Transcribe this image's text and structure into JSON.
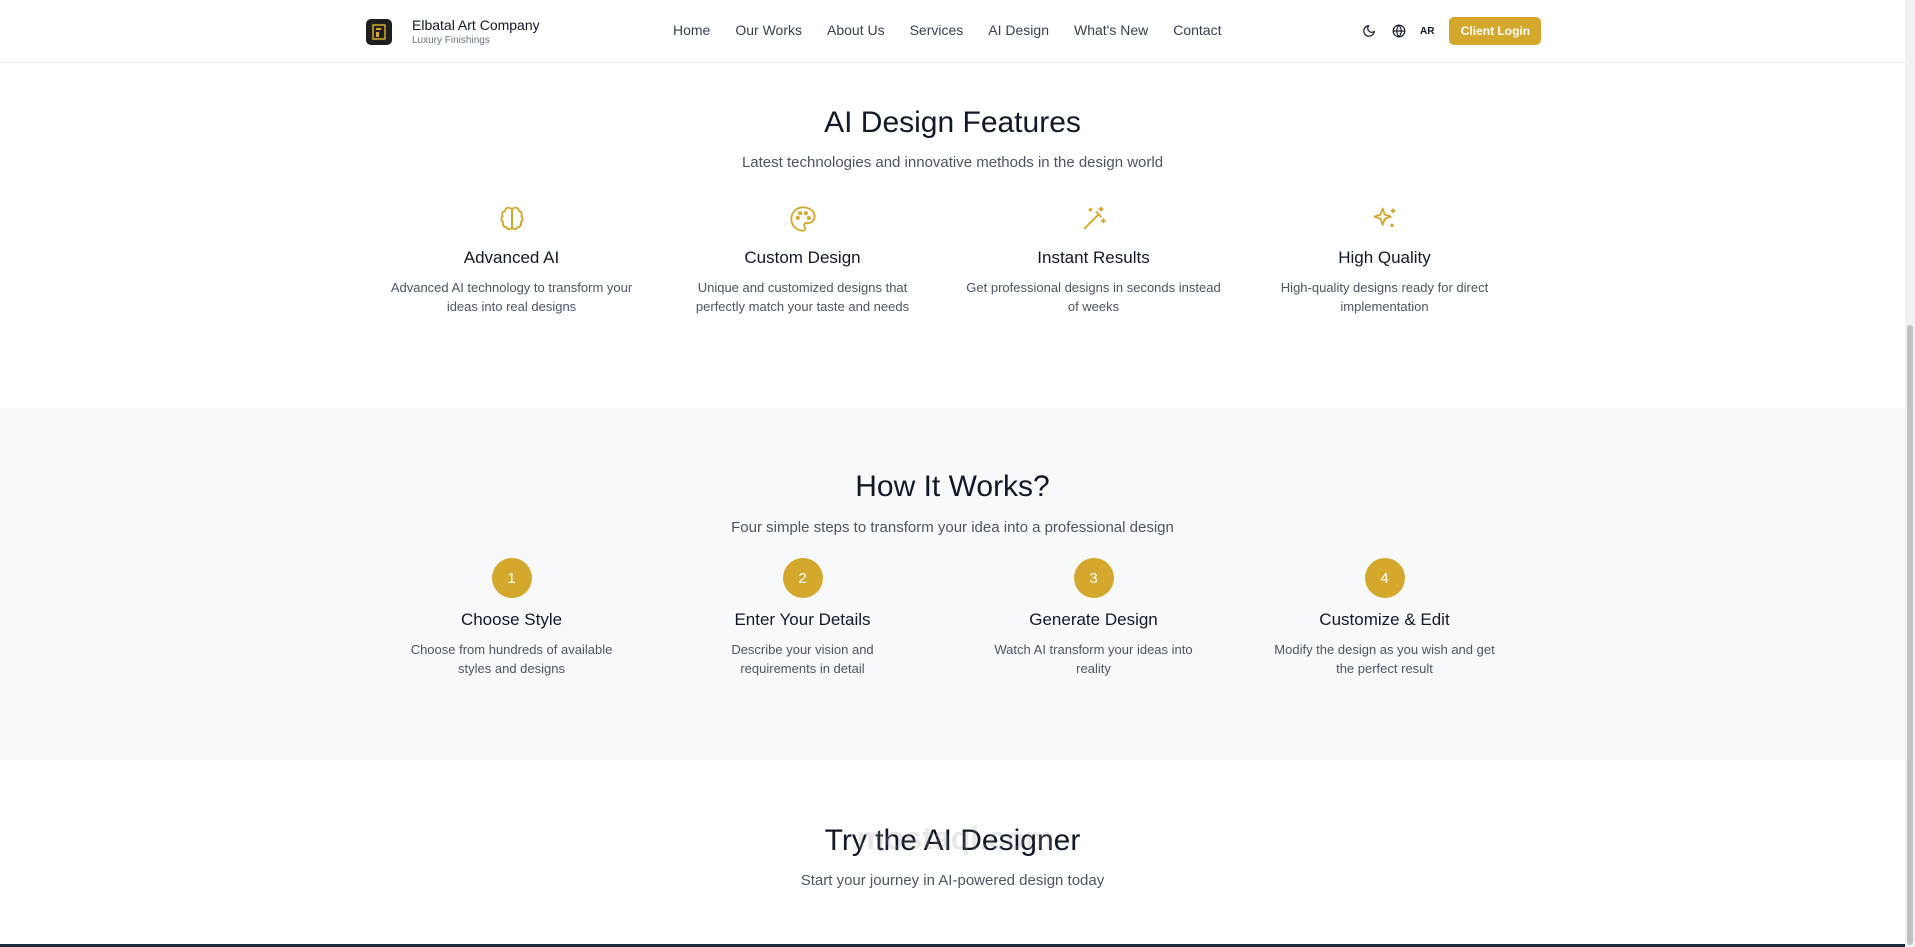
{
  "header": {
    "brand_name": "Elbatal Art Company",
    "brand_sub": "Luxury Finishings",
    "nav": [
      "Home",
      "Our Works",
      "About Us",
      "Services",
      "AI Design",
      "What's New",
      "Contact"
    ],
    "lang": "AR",
    "login": "Client Login"
  },
  "features": {
    "title": "AI Design Features",
    "subtitle": "Latest technologies and innovative methods in the design world",
    "items": [
      {
        "title": "Advanced AI",
        "desc": "Advanced AI technology to transform your ideas into real designs",
        "icon": "brain-icon"
      },
      {
        "title": "Custom Design",
        "desc": "Unique and customized designs that perfectly match your taste and needs",
        "icon": "palette-icon"
      },
      {
        "title": "Instant Results",
        "desc": "Get professional designs in seconds instead of weeks",
        "icon": "magic-wand-icon"
      },
      {
        "title": "High Quality",
        "desc": "High-quality designs ready for direct implementation",
        "icon": "sparkles-icon"
      }
    ]
  },
  "how": {
    "title": "How It Works?",
    "subtitle": "Four simple steps to transform your idea into a professional design",
    "steps": [
      {
        "num": "1",
        "title": "Choose Style",
        "desc": "Choose from hundreds of available styles and designs"
      },
      {
        "num": "2",
        "title": "Enter Your Details",
        "desc": "Describe your vision and requirements in detail"
      },
      {
        "num": "3",
        "title": "Generate Design",
        "desc": "Watch AI transform your ideas into reality"
      },
      {
        "num": "4",
        "title": "Customize & Edit",
        "desc": "Modify the design as you wish and get the perfect result"
      }
    ]
  },
  "try": {
    "title": "Try the AI Designer",
    "subtitle": "Start your journey in AI-powered design today"
  },
  "watermark": "mostaql.com",
  "colors": {
    "accent": "#d4a82c",
    "muted_bg": "#f8f9fa"
  }
}
